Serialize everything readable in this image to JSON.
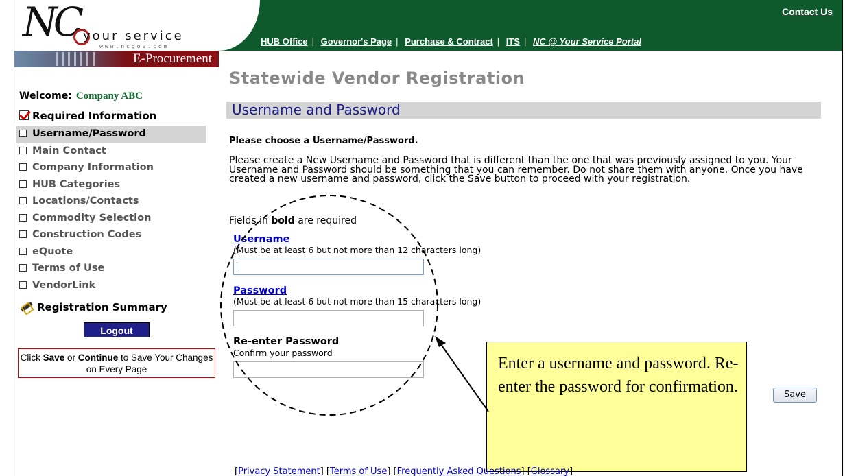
{
  "header": {
    "logo_tagline": "your service",
    "logo_url": "www.ncgov.com",
    "section_banner": "E-Procurement",
    "contact_link": "Contact Us",
    "nav_links": [
      "HUB Office",
      "Governor's Page",
      "Purchase & Contract",
      "ITS",
      "NC @ Your Service Portal"
    ]
  },
  "sidebar": {
    "welcome_label": "Welcome:",
    "company_name": "Company ABC",
    "required_heading": "Required Information",
    "items": [
      {
        "label": "Username/Password",
        "active": true
      },
      {
        "label": "Main Contact"
      },
      {
        "label": "Company Information"
      },
      {
        "label": "HUB Categories"
      },
      {
        "label": "Locations/Contacts"
      },
      {
        "label": "Commodity Selection"
      },
      {
        "label": "Construction Codes"
      },
      {
        "label": "eQuote"
      },
      {
        "label": "Terms of Use"
      },
      {
        "label": "VendorLink"
      }
    ],
    "summary_label": "Registration Summary",
    "logout_label": "Logout",
    "save_note_pre": "Click ",
    "save_note_save": "Save",
    "save_note_mid": " or ",
    "save_note_continue": "Continue",
    "save_note_post": " to Save Your Changes on Every Page"
  },
  "main": {
    "page_title": "Statewide Vendor Registration",
    "section_title": "Username and Password",
    "instruction": "Please choose a Username/Password.",
    "paragraph": "Please create a New Username and Password that is different than the one that was previously assigned to you. Your Username and Password should be something that you can remember. Do not share them with anyone. Once you have created a new username and password, click the Save button to proceed with your registration.",
    "fields_note_pre": "Fields in ",
    "fields_note_bold": "bold",
    "fields_note_post": " are required",
    "username_label": "Username",
    "username_hint": "(Must be at least 6 but not more than 12 characters long)",
    "username_value": "",
    "password_label": "Password",
    "password_hint": "(Must be at least 6 but not more than 15 characters long)",
    "password_value": "",
    "reenter_label": "Re-enter Password",
    "reenter_hint": "Confirm your password",
    "reenter_value": "",
    "save_label": "Save"
  },
  "callout": {
    "text": "Enter a username and password.  Re-enter the password for confirmation."
  },
  "footer": {
    "links": [
      "Privacy Statement",
      "Terms of Use",
      "Frequently Asked Questions",
      "Glossary"
    ]
  }
}
